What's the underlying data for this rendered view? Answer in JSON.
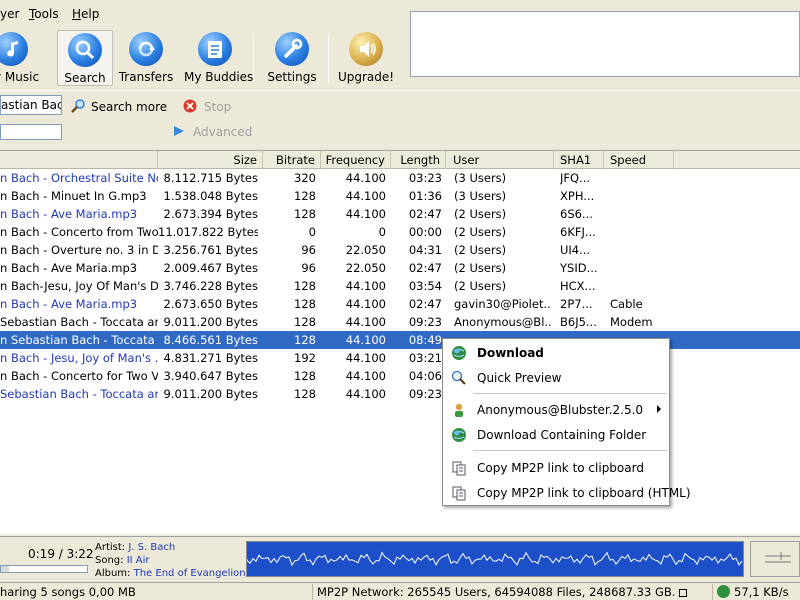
{
  "menu": [
    {
      "label": "yer",
      "underline": ""
    },
    {
      "label": "ools",
      "underline": "T"
    },
    {
      "label": "elp",
      "underline": "H"
    }
  ],
  "toolbar": {
    "my_music": "y Music",
    "search": "Search",
    "transfers": "Transfers",
    "my_buddies": "My Buddies",
    "settings": "Settings",
    "upgrade": "Upgrade!"
  },
  "search": {
    "query": "astian Bach",
    "search_more": "Search more",
    "stop": "Stop",
    "advanced": "Advanced"
  },
  "table": {
    "columns": [
      "Size",
      "Bitrate",
      "Frequency",
      "Length",
      "User",
      "SHA1",
      "Speed"
    ],
    "rows": [
      {
        "name": "n Bach - Orchestral Suite No...",
        "size": "8.112.715 Bytes",
        "bitrate": "320",
        "freq": "44.100",
        "length": "03:23",
        "user": "(3 Users)",
        "sha1": "JFQ...",
        "speed": "",
        "blue": true
      },
      {
        "name": "n Bach - Minuet In G.mp3",
        "size": "1.538.048 Bytes",
        "bitrate": "128",
        "freq": "44.100",
        "length": "01:36",
        "user": "(3 Users)",
        "sha1": "XPH...",
        "speed": "",
        "blue": false
      },
      {
        "name": "n Bach - Ave Maria.mp3",
        "size": "2.673.394 Bytes",
        "bitrate": "128",
        "freq": "44.100",
        "length": "02:47",
        "user": "(2 Users)",
        "sha1": "6S6...",
        "speed": "",
        "blue": true
      },
      {
        "name": "n Bach - Concerto from Two ...",
        "size": "11.017.822 Bytes",
        "bitrate": "0",
        "freq": "0",
        "length": "00:00",
        "user": "(2 Users)",
        "sha1": "6KFJ...",
        "speed": "",
        "blue": false
      },
      {
        "name": "n Bach - Overture no. 3 in D...",
        "size": "3.256.761 Bytes",
        "bitrate": "96",
        "freq": "22.050",
        "length": "04:31",
        "user": "(2 Users)",
        "sha1": "UI4...",
        "speed": "",
        "blue": false
      },
      {
        "name": "n Bach - Ave Maria.mp3",
        "size": "2.009.467 Bytes",
        "bitrate": "96",
        "freq": "22.050",
        "length": "02:47",
        "user": "(2 Users)",
        "sha1": "YSID...",
        "speed": "",
        "blue": false
      },
      {
        "name": "n Bach-Jesu, Joy Of Man's D...",
        "size": "3.746.228 Bytes",
        "bitrate": "128",
        "freq": "44.100",
        "length": "03:54",
        "user": "(2 Users)",
        "sha1": "HCX...",
        "speed": "",
        "blue": false
      },
      {
        "name": "n Bach - Ave Maria.mp3",
        "size": "2.673.650 Bytes",
        "bitrate": "128",
        "freq": "44.100",
        "length": "02:47",
        "user": "gavin30@Piolet...",
        "sha1": "2P7...",
        "speed": "Cable",
        "blue": true
      },
      {
        "name": "Sebastian Bach - Toccata an...",
        "size": "9.011.200 Bytes",
        "bitrate": "128",
        "freq": "44.100",
        "length": "09:23",
        "user": "Anonymous@Bl...",
        "sha1": "B6J5...",
        "speed": "Modem",
        "blue": false
      },
      {
        "name": "n Sebastian Bach - Toccata a...",
        "size": "8.466.561 Bytes",
        "bitrate": "128",
        "freq": "44.100",
        "length": "08:49",
        "user": "",
        "sha1": "",
        "speed": "",
        "blue": false,
        "selected": true
      },
      {
        "name": "n Bach - Jesu, Joy of Man's ...",
        "size": "4.831.271 Bytes",
        "bitrate": "192",
        "freq": "44.100",
        "length": "03:21",
        "user": "",
        "sha1": "",
        "speed": "",
        "blue": true
      },
      {
        "name": "n Bach - Concerto for Two Vi...",
        "size": "3.940.647 Bytes",
        "bitrate": "128",
        "freq": "44.100",
        "length": "04:06",
        "user": "",
        "sha1": "",
        "speed": "",
        "blue": false
      },
      {
        "name": "Sebastian Bach - Toccata an...",
        "size": "9.011.200 Bytes",
        "bitrate": "128",
        "freq": "44.100",
        "length": "09:23",
        "user": "",
        "sha1": "",
        "speed": "",
        "blue": true
      }
    ]
  },
  "context_menu": {
    "download": "Download",
    "quick_preview": "Quick Preview",
    "user": "Anonymous@Blubster.2.5.0",
    "download_folder": "Download Containing Folder",
    "copy_link": "Copy MP2P link to clipboard",
    "copy_link_html": "Copy MP2P link to clipboard (HTML)"
  },
  "player": {
    "time": "0:19 / 3:22",
    "artist_label": "Artist:",
    "artist": "J. S. Bach",
    "song_label": "Song:",
    "song": "II Air",
    "album_label": "Album:",
    "album": "The End of Evangelion",
    "progress": 0.09
  },
  "status": {
    "sharing": "haring 5 songs 0,00 MB",
    "network": "MP2P Network: 265545 Users, 64594088 Files, 248687.33 GB.",
    "speed": "57,1 KB/s"
  },
  "colors": {
    "selection": "#316ac5",
    "link_blue": "#2039b5",
    "wave_bg": "#1c4fc8"
  }
}
